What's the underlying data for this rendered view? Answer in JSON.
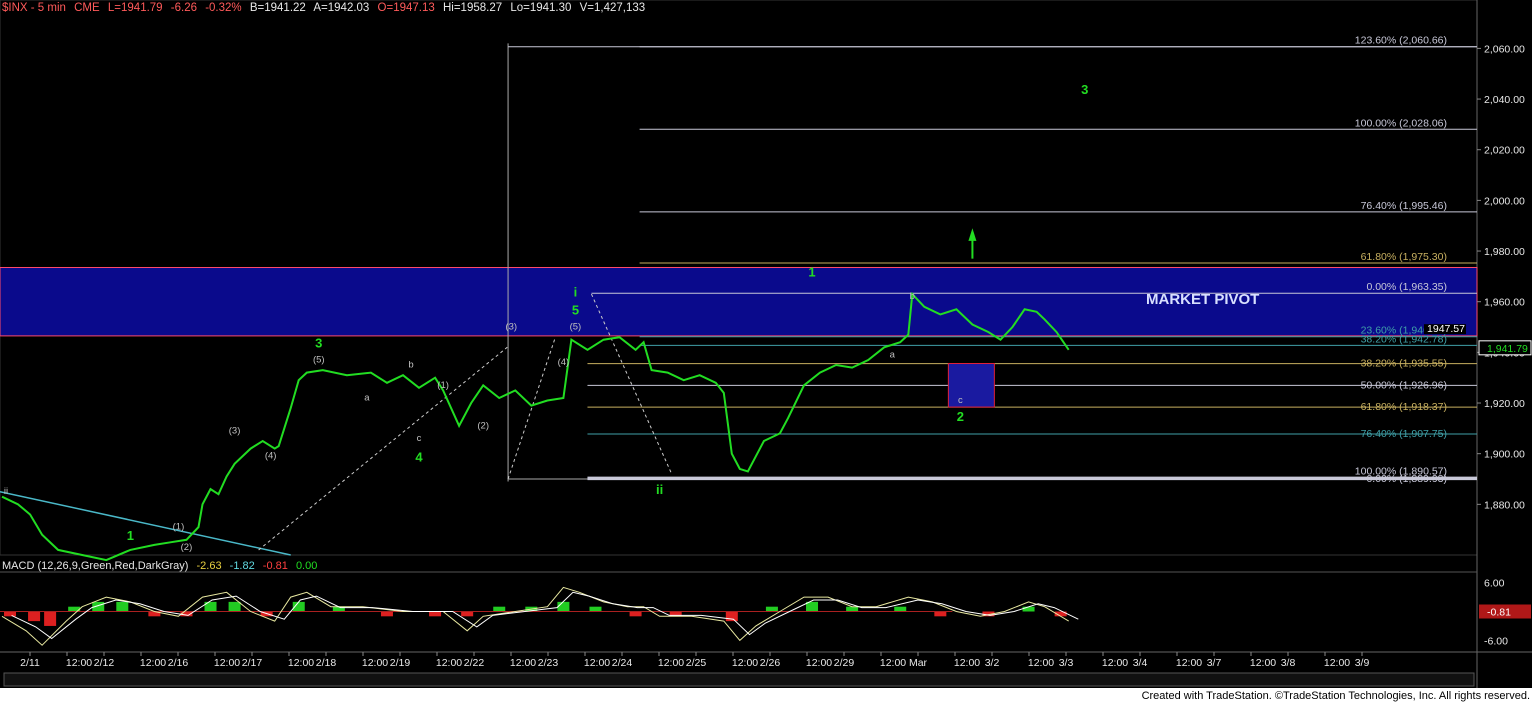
{
  "header": {
    "symbol": "$INX - 5 min",
    "exchange": "CME",
    "last": "L=1941.79",
    "change": "-6.26",
    "change_pct": "-0.32%",
    "bid": "B=1941.22",
    "ask": "A=1942.03",
    "open": "O=1947.13",
    "high": "Hi=1958.27",
    "low": "Lo=1941.30",
    "volume": "V=1,427,133"
  },
  "macd_header": {
    "label": "MACD (12,26,9,Green,Red,DarkGray)",
    "v1": "-2.63",
    "v2": "-1.82",
    "v3": "-0.81",
    "v4": "0.00"
  },
  "footer": "Created with TradeStation. ©TradeStation Technologies, Inc. All rights reserved.",
  "pivot_label": "MARKET PIVOT",
  "colors": {
    "background": "#000000",
    "price": "#22dd22",
    "pivot_zone": "#0a0a8c",
    "pivot_border": "#ff4a6a",
    "fib_white": "#c8c8d8",
    "fib_olive": "#c8b060",
    "fib_teal": "#40a0a8",
    "trendline": "#4ab8c8",
    "target_box": "#1a1aa0",
    "target_border": "#e0203a",
    "wave_label": "#22dd22",
    "sub_label": "#c0c0c0"
  },
  "chart_data": {
    "type": "line",
    "title": "$INX - 5 min",
    "ylim": [
      1860,
      2072
    ],
    "y_ticks": [
      "2,060.00",
      "2,040.00",
      "2,020.00",
      "2,000.00",
      "1,980.00",
      "1,960.00",
      "1,940.00",
      "1,920.00",
      "1,900.00",
      "1,880.00"
    ],
    "y_tick_values": [
      2060,
      2040,
      2020,
      2000,
      1980,
      1960,
      1940,
      1920,
      1900,
      1880
    ],
    "last_price_label": "1,941.79",
    "x_ticks": [
      "2/11",
      "12:00",
      "2/12",
      "12:00",
      "2/16",
      "12:00",
      "2/17",
      "12:00",
      "2/18",
      "12:00",
      "2/19",
      "12:00",
      "2/22",
      "12:00",
      "2/23",
      "12:00",
      "2/24",
      "12:00",
      "2/25",
      "12:00",
      "2/26",
      "12:00",
      "2/29",
      "12:00",
      "Mar",
      "12:00",
      "3/2",
      "12:00",
      "3/3",
      "12:00",
      "3/4",
      "12:00",
      "3/7",
      "12:00",
      "3/8",
      "12:00",
      "3/9"
    ],
    "price_path": [
      [
        0,
        1883
      ],
      [
        0.2,
        1880
      ],
      [
        0.35,
        1876
      ],
      [
        0.5,
        1868
      ],
      [
        0.7,
        1862
      ],
      [
        1.0,
        1860
      ],
      [
        1.3,
        1858
      ],
      [
        1.6,
        1862
      ],
      [
        1.9,
        1864
      ],
      [
        2.1,
        1865
      ],
      [
        2.3,
        1866
      ],
      [
        2.45,
        1871
      ],
      [
        2.5,
        1880
      ],
      [
        2.6,
        1886
      ],
      [
        2.7,
        1884
      ],
      [
        2.8,
        1891
      ],
      [
        2.9,
        1896
      ],
      [
        3.1,
        1902
      ],
      [
        3.25,
        1905
      ],
      [
        3.4,
        1902
      ],
      [
        3.45,
        1903
      ],
      [
        3.6,
        1918
      ],
      [
        3.7,
        1929
      ],
      [
        3.8,
        1932
      ],
      [
        4.0,
        1933
      ],
      [
        4.3,
        1931
      ],
      [
        4.6,
        1932
      ],
      [
        4.8,
        1928
      ],
      [
        5.0,
        1931
      ],
      [
        5.2,
        1926
      ],
      [
        5.4,
        1930
      ],
      [
        5.5,
        1925
      ],
      [
        5.7,
        1911
      ],
      [
        5.85,
        1920
      ],
      [
        6.0,
        1927
      ],
      [
        6.2,
        1922
      ],
      [
        6.4,
        1925
      ],
      [
        6.6,
        1919
      ],
      [
        6.8,
        1921
      ],
      [
        7.0,
        1922
      ],
      [
        7.1,
        1945
      ],
      [
        7.3,
        1941
      ],
      [
        7.5,
        1945
      ],
      [
        7.7,
        1946
      ],
      [
        7.9,
        1941
      ],
      [
        8.0,
        1944
      ],
      [
        8.1,
        1933
      ],
      [
        8.3,
        1932
      ],
      [
        8.5,
        1929
      ],
      [
        8.7,
        1931
      ],
      [
        8.9,
        1928
      ],
      [
        9.0,
        1924
      ],
      [
        9.1,
        1900
      ],
      [
        9.2,
        1894
      ],
      [
        9.3,
        1893
      ],
      [
        9.4,
        1899
      ],
      [
        9.5,
        1905
      ],
      [
        9.7,
        1908
      ],
      [
        9.8,
        1914
      ],
      [
        10.0,
        1927
      ],
      [
        10.2,
        1932
      ],
      [
        10.4,
        1935
      ],
      [
        10.6,
        1934
      ],
      [
        10.8,
        1937
      ],
      [
        11.0,
        1942
      ],
      [
        11.2,
        1944
      ],
      [
        11.3,
        1947
      ],
      [
        11.35,
        1963
      ],
      [
        11.5,
        1958
      ],
      [
        11.7,
        1955
      ],
      [
        11.9,
        1957
      ],
      [
        12.1,
        1951
      ],
      [
        12.3,
        1948
      ],
      [
        12.45,
        1945
      ],
      [
        12.6,
        1950
      ],
      [
        12.75,
        1957
      ],
      [
        12.9,
        1956
      ],
      [
        13.0,
        1953
      ],
      [
        13.15,
        1948
      ],
      [
        13.3,
        1941
      ]
    ],
    "macd_ylim": [
      -8,
      8
    ],
    "macd_ticks": [
      "6.00",
      "-6.00"
    ],
    "macd_tick_values": [
      6,
      -6
    ],
    "macd_last_label": "-0.81",
    "macd_path": [
      [
        0,
        -1
      ],
      [
        0.3,
        -4
      ],
      [
        0.5,
        -7
      ],
      [
        0.8,
        -2
      ],
      [
        1.0,
        1
      ],
      [
        1.3,
        3
      ],
      [
        1.6,
        2
      ],
      [
        1.9,
        0
      ],
      [
        2.2,
        -1
      ],
      [
        2.5,
        3
      ],
      [
        2.8,
        4
      ],
      [
        3.1,
        0
      ],
      [
        3.4,
        -2
      ],
      [
        3.6,
        3
      ],
      [
        3.8,
        4
      ],
      [
        4.1,
        1
      ],
      [
        4.5,
        1
      ],
      [
        5.0,
        0
      ],
      [
        5.5,
        0
      ],
      [
        5.8,
        -4
      ],
      [
        6.0,
        -1
      ],
      [
        6.4,
        0
      ],
      [
        6.8,
        1
      ],
      [
        7.0,
        5
      ],
      [
        7.2,
        4
      ],
      [
        7.5,
        2
      ],
      [
        7.8,
        1
      ],
      [
        8.0,
        1
      ],
      [
        8.2,
        -1
      ],
      [
        8.6,
        -1
      ],
      [
        9.0,
        -2
      ],
      [
        9.2,
        -6
      ],
      [
        9.4,
        -3
      ],
      [
        9.7,
        0
      ],
      [
        10.0,
        3
      ],
      [
        10.3,
        3
      ],
      [
        10.6,
        1
      ],
      [
        10.9,
        1
      ],
      [
        11.3,
        3
      ],
      [
        11.6,
        2
      ],
      [
        11.9,
        0
      ],
      [
        12.2,
        -1
      ],
      [
        12.5,
        0
      ],
      [
        12.8,
        2
      ],
      [
        13.0,
        1
      ],
      [
        13.3,
        -2
      ]
    ],
    "macd_hist": [
      [
        0.1,
        -1
      ],
      [
        0.4,
        -2
      ],
      [
        0.6,
        -3
      ],
      [
        0.9,
        1
      ],
      [
        1.2,
        2
      ],
      [
        1.5,
        2
      ],
      [
        1.9,
        -1
      ],
      [
        2.3,
        -1
      ],
      [
        2.6,
        2
      ],
      [
        2.9,
        2
      ],
      [
        3.3,
        -1
      ],
      [
        3.7,
        2
      ],
      [
        4.2,
        1
      ],
      [
        4.8,
        -1
      ],
      [
        5.4,
        -1
      ],
      [
        5.8,
        -1
      ],
      [
        6.2,
        1
      ],
      [
        6.6,
        1
      ],
      [
        7.0,
        2
      ],
      [
        7.4,
        1
      ],
      [
        7.9,
        -1
      ],
      [
        8.4,
        -1
      ],
      [
        9.1,
        -2
      ],
      [
        9.6,
        1
      ],
      [
        10.1,
        2
      ],
      [
        10.6,
        1
      ],
      [
        11.2,
        1
      ],
      [
        11.7,
        -1
      ],
      [
        12.3,
        -1
      ],
      [
        12.8,
        1
      ],
      [
        13.2,
        -1
      ]
    ],
    "fib_upper": [
      {
        "label": "123.60% (2,060.66)",
        "value": 2060.66
      },
      {
        "label": "100.00% (2,028.06)",
        "value": 2028.06
      },
      {
        "label": "76.40% (1,995.46)",
        "value": 1995.46
      },
      {
        "label": "61.80% (1,975.30)",
        "value": 1975.3
      },
      {
        "label": "0.00% (1,963.35)",
        "value": 1963.35
      },
      {
        "label": "23.60% (1,946.18)",
        "value": 1946.18
      },
      {
        "label": "38.20% (1,942.78)",
        "value": 1942.78
      }
    ],
    "fib_lower": [
      {
        "label": "38.20% (1,935.55)",
        "value": 1935.55
      },
      {
        "label": "50.00% (1,926.96)",
        "value": 1926.96
      },
      {
        "label": "61.80% (1,918.37)",
        "value": 1918.37
      },
      {
        "label": "76.40% (1,907.75)",
        "value": 1907.75
      },
      {
        "label": "100.00% (1,890.57)",
        "value": 1890.57
      },
      {
        "label": "0.00% (1,889.93)",
        "value": 1889.93
      }
    ],
    "pivot_zone": [
      1946.5,
      1973.5
    ],
    "target_box": [
      1918.4,
      1935.6
    ],
    "price_marker_label": "1947.57",
    "price_marker_value": 1947.57,
    "wave_labels": [
      {
        "t": "ii",
        "x": 0.05,
        "y": 1884,
        "c": "sub"
      },
      {
        "t": "1",
        "x": 1.6,
        "y": 1866,
        "c": "wave"
      },
      {
        "t": "(1)",
        "x": 2.2,
        "y": 1870,
        "c": "sub"
      },
      {
        "t": "(2)",
        "x": 2.3,
        "y": 1862,
        "c": "sub"
      },
      {
        "t": "(3)",
        "x": 2.9,
        "y": 1908,
        "c": "sub"
      },
      {
        "t": "(4)",
        "x": 3.35,
        "y": 1898,
        "c": "sub"
      },
      {
        "t": "3",
        "x": 3.95,
        "y": 1942,
        "c": "wave"
      },
      {
        "t": "(5)",
        "x": 3.95,
        "y": 1936,
        "c": "sub"
      },
      {
        "t": "a",
        "x": 4.55,
        "y": 1921,
        "c": "sub"
      },
      {
        "t": "b",
        "x": 5.1,
        "y": 1934,
        "c": "sub"
      },
      {
        "t": "(1)",
        "x": 5.5,
        "y": 1926,
        "c": "sub"
      },
      {
        "t": "c",
        "x": 5.2,
        "y": 1905,
        "c": "sub"
      },
      {
        "t": "4",
        "x": 5.2,
        "y": 1897,
        "c": "wave"
      },
      {
        "t": "(2)",
        "x": 6.0,
        "y": 1910,
        "c": "sub"
      },
      {
        "t": "(3)",
        "x": 6.35,
        "y": 1949,
        "c": "sub"
      },
      {
        "t": "i",
        "x": 7.15,
        "y": 1962,
        "c": "wave"
      },
      {
        "t": "5",
        "x": 7.15,
        "y": 1955,
        "c": "wave"
      },
      {
        "t": "(5)",
        "x": 7.15,
        "y": 1949,
        "c": "sub"
      },
      {
        "t": "(4)",
        "x": 7.0,
        "y": 1935,
        "c": "sub"
      },
      {
        "t": "ii",
        "x": 8.2,
        "y": 1884,
        "c": "wave"
      },
      {
        "t": "1",
        "x": 10.1,
        "y": 1970,
        "c": "wave"
      },
      {
        "t": "a",
        "x": 11.1,
        "y": 1938,
        "c": "sub"
      },
      {
        "t": "b",
        "x": 11.35,
        "y": 1961,
        "c": "sub"
      },
      {
        "t": "c",
        "x": 11.95,
        "y": 1920,
        "c": "sub"
      },
      {
        "t": "2",
        "x": 11.95,
        "y": 1913,
        "c": "wave"
      },
      {
        "t": "3",
        "x": 13.5,
        "y": 2042,
        "c": "wave"
      }
    ]
  }
}
